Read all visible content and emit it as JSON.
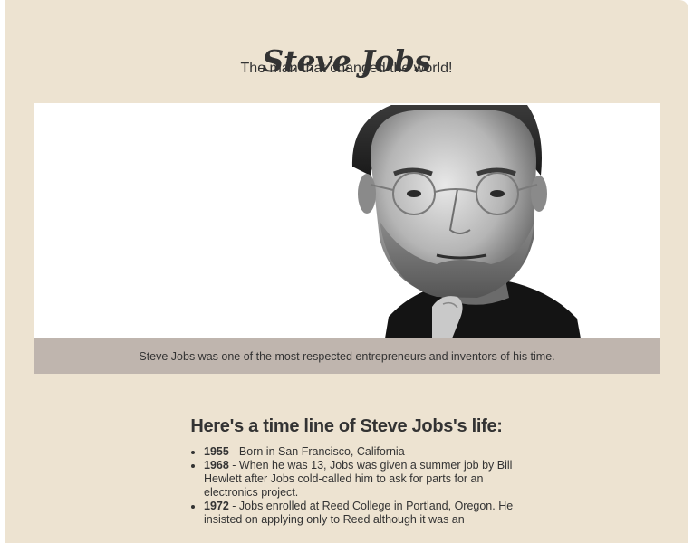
{
  "header": {
    "title": "Steve Jobs",
    "subtitle": "The man that changed the world!"
  },
  "figure": {
    "image_alt": "Steve Jobs portrait",
    "caption": "Steve Jobs was one of the most respected entrepreneurs and inventors of his time."
  },
  "timeline": {
    "heading": "Here's a time line of Steve Jobs's life:",
    "items": [
      {
        "year": "1955",
        "text": " - Born in San Francisco, California"
      },
      {
        "year": "1968",
        "text": " - When he was 13, Jobs was given a summer job by Bill Hewlett after Jobs cold-called him to ask for parts for an electronics project."
      },
      {
        "year": "1972",
        "text": " - Jobs enrolled at Reed College in Portland, Oregon. He insisted on applying only to Reed although it was an"
      }
    ]
  },
  "colors": {
    "page_background": "#ede3d1",
    "caption_background": "#bfb5ae",
    "text": "#333333"
  }
}
